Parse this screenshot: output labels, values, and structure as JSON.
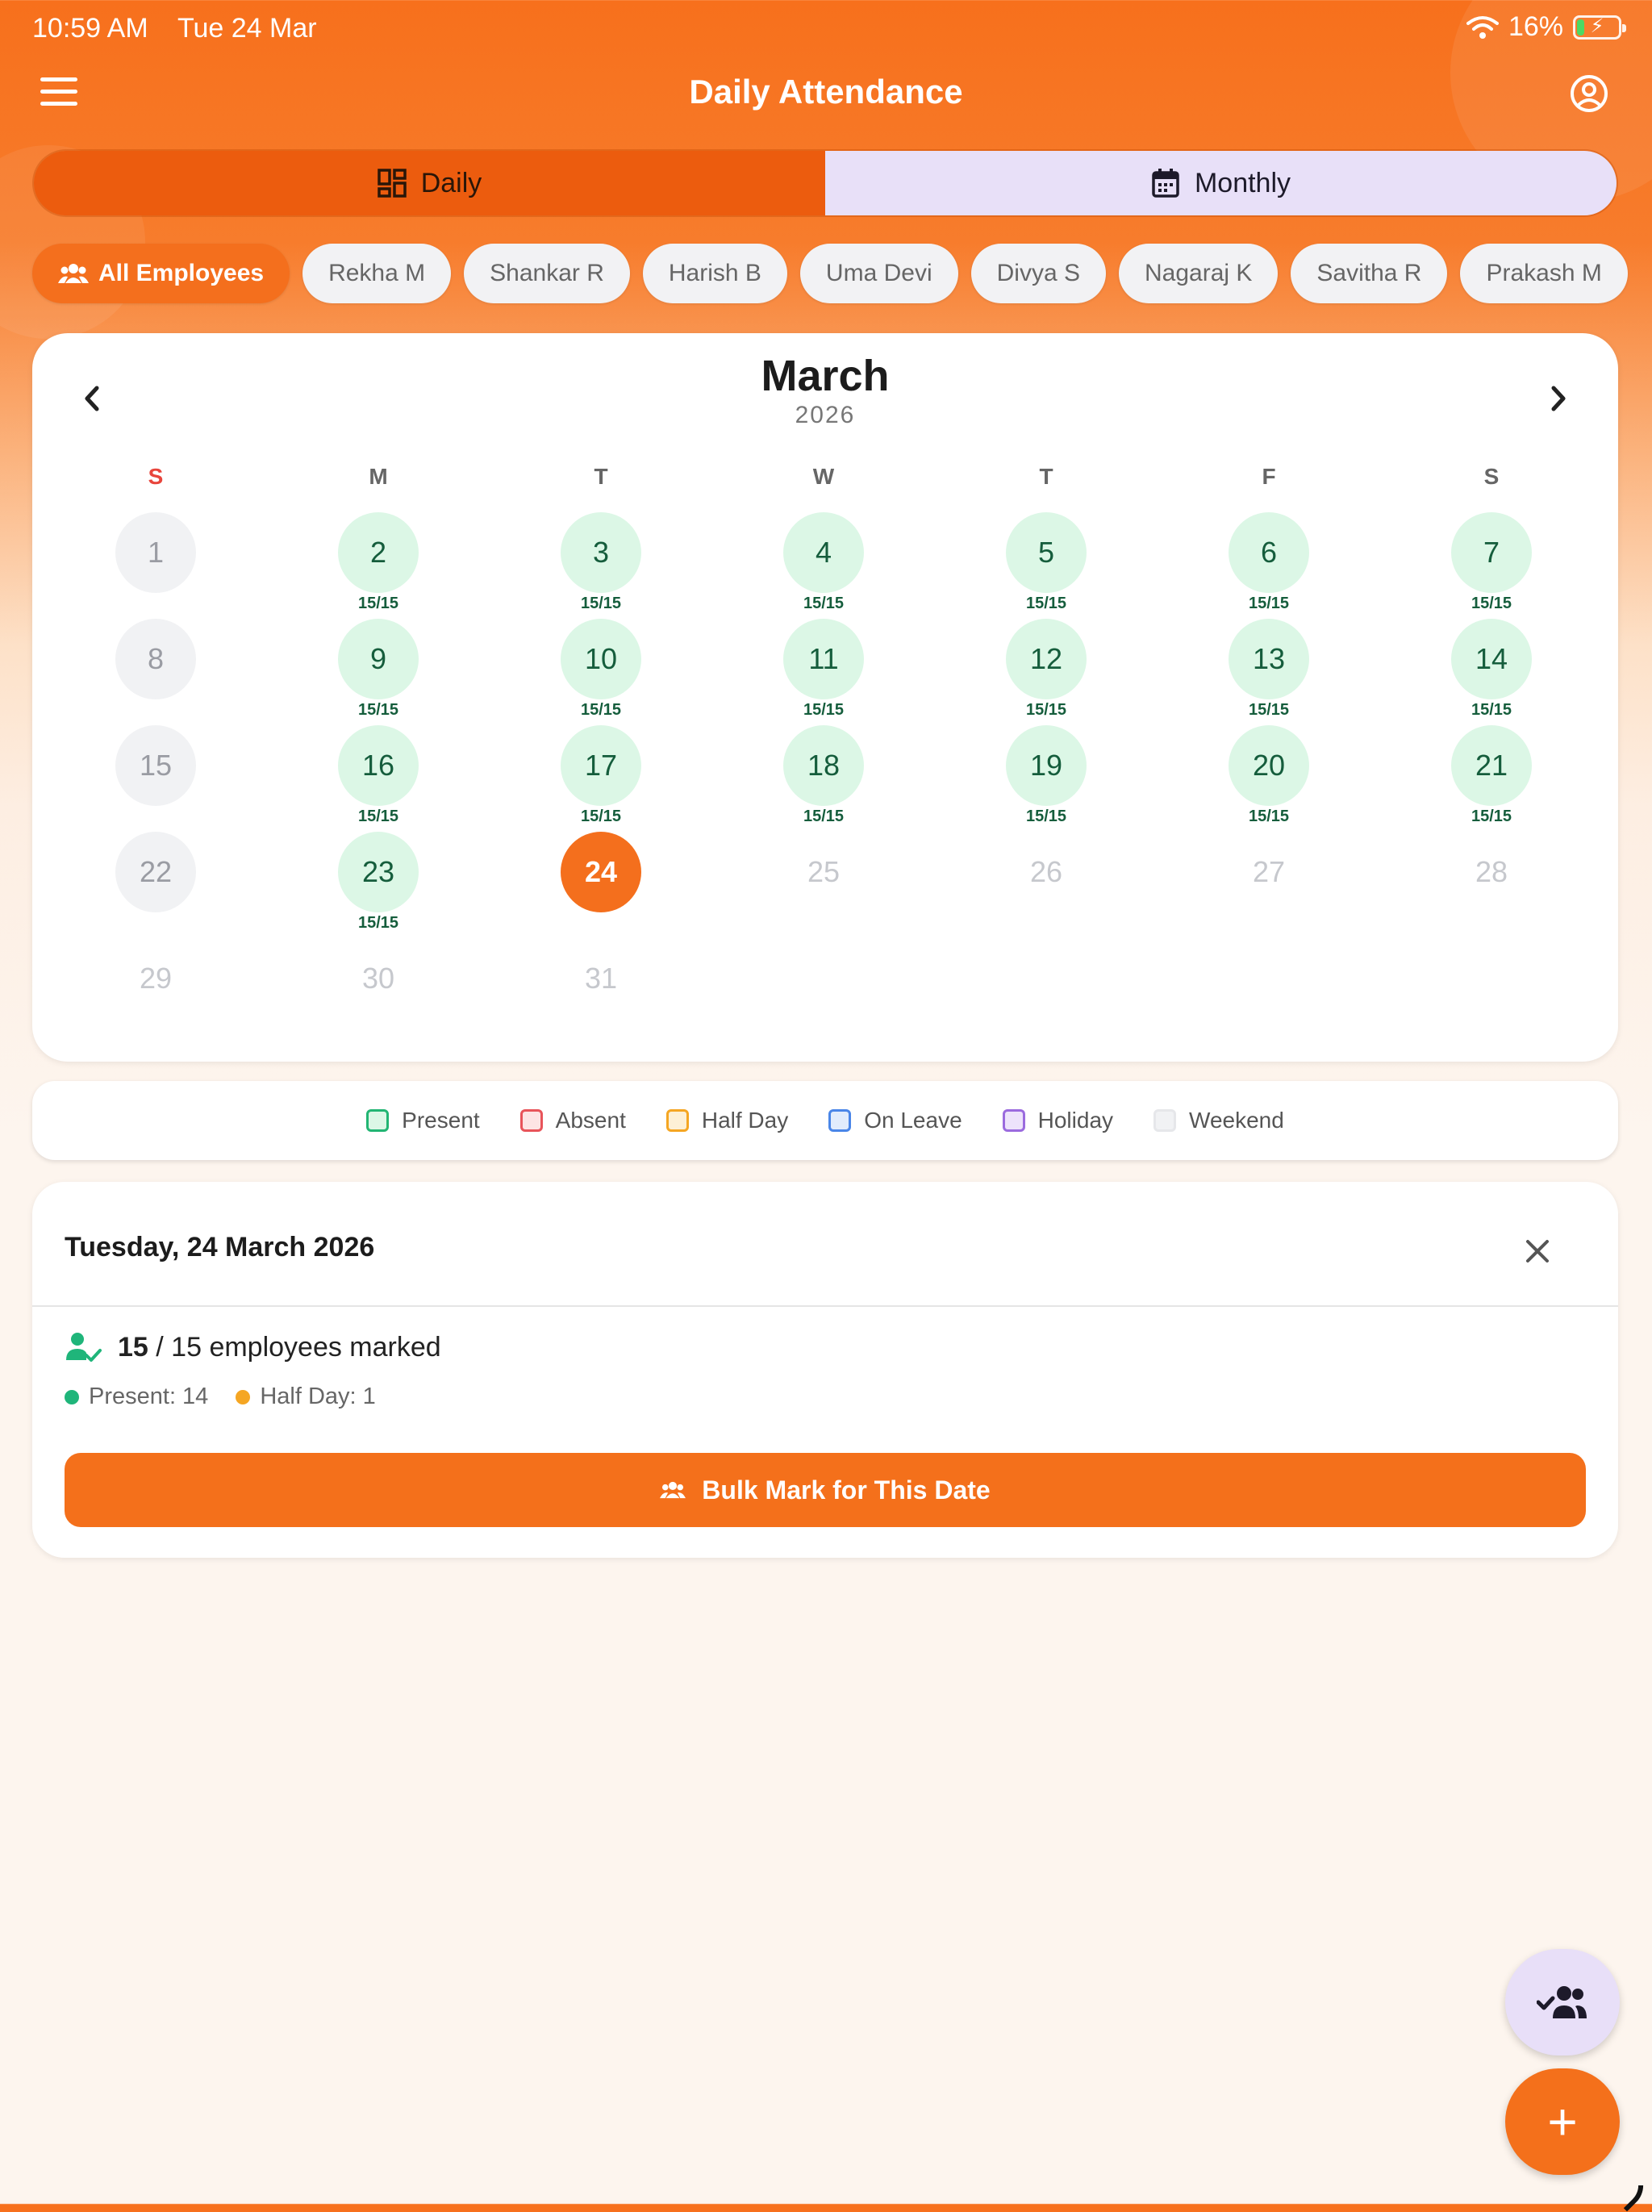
{
  "status_bar": {
    "time": "10:59 AM",
    "date": "Tue 24 Mar",
    "battery_percent": "16%",
    "battery_level": 0.16,
    "charging": true
  },
  "app_bar": {
    "title": "Daily Attendance",
    "menu_icon": "hamburger-menu-icon",
    "profile_icon": "account-circle-icon"
  },
  "view_toggle": {
    "daily_label": "Daily",
    "monthly_label": "Monthly",
    "selected": "Monthly"
  },
  "employee_filter": {
    "selected": "All Employees",
    "chips": [
      "All Employees",
      "Rekha M",
      "Shankar R",
      "Harish B",
      "Uma Devi",
      "Divya S",
      "Nagaraj K",
      "Savitha R",
      "Prakash M"
    ]
  },
  "calendar": {
    "month": "March",
    "year": "2026",
    "weekday_headers": [
      "S",
      "M",
      "T",
      "W",
      "T",
      "F",
      "S"
    ],
    "today": 24,
    "days": [
      {
        "day": "1",
        "status": "weekend",
        "count": ""
      },
      {
        "day": "2",
        "status": "present",
        "count": "15/15"
      },
      {
        "day": "3",
        "status": "present",
        "count": "15/15"
      },
      {
        "day": "4",
        "status": "present",
        "count": "15/15"
      },
      {
        "day": "5",
        "status": "present",
        "count": "15/15"
      },
      {
        "day": "6",
        "status": "present",
        "count": "15/15"
      },
      {
        "day": "7",
        "status": "present",
        "count": "15/15"
      },
      {
        "day": "8",
        "status": "weekend",
        "count": ""
      },
      {
        "day": "9",
        "status": "present",
        "count": "15/15"
      },
      {
        "day": "10",
        "status": "present",
        "count": "15/15"
      },
      {
        "day": "11",
        "status": "present",
        "count": "15/15"
      },
      {
        "day": "12",
        "status": "present",
        "count": "15/15"
      },
      {
        "day": "13",
        "status": "present",
        "count": "15/15"
      },
      {
        "day": "14",
        "status": "present",
        "count": "15/15"
      },
      {
        "day": "15",
        "status": "weekend",
        "count": ""
      },
      {
        "day": "16",
        "status": "present",
        "count": "15/15"
      },
      {
        "day": "17",
        "status": "present",
        "count": "15/15"
      },
      {
        "day": "18",
        "status": "present",
        "count": "15/15"
      },
      {
        "day": "19",
        "status": "present",
        "count": "15/15"
      },
      {
        "day": "20",
        "status": "present",
        "count": "15/15"
      },
      {
        "day": "21",
        "status": "present",
        "count": "15/15"
      },
      {
        "day": "22",
        "status": "weekend",
        "count": ""
      },
      {
        "day": "23",
        "status": "present",
        "count": "15/15"
      },
      {
        "day": "24",
        "status": "today",
        "count": ""
      },
      {
        "day": "25",
        "status": "future",
        "count": ""
      },
      {
        "day": "26",
        "status": "future",
        "count": ""
      },
      {
        "day": "27",
        "status": "future",
        "count": ""
      },
      {
        "day": "28",
        "status": "future",
        "count": ""
      },
      {
        "day": "29",
        "status": "future",
        "count": ""
      },
      {
        "day": "30",
        "status": "future",
        "count": ""
      },
      {
        "day": "31",
        "status": "future",
        "count": ""
      }
    ]
  },
  "legend": [
    {
      "label": "Present",
      "border": "#22b573",
      "fill": "#dcf7e6"
    },
    {
      "label": "Absent",
      "border": "#e8545a",
      "fill": "#fde4e4"
    },
    {
      "label": "Half Day",
      "border": "#f5a623",
      "fill": "#fdf0d6"
    },
    {
      "label": "On Leave",
      "border": "#4a86e8",
      "fill": "#e1ecfc"
    },
    {
      "label": "Holiday",
      "border": "#9b6bde",
      "fill": "#ede3fb"
    },
    {
      "label": "Weekend",
      "border": "#e6e7ea",
      "fill": "#f1f2f4"
    }
  ],
  "day_detail": {
    "date_title": "Tuesday, 24 March 2026",
    "marked_count": "15",
    "marked_rest": "/ 15 employees marked",
    "present_label": "Present: 14",
    "half_day_label": "Half Day: 1",
    "present_color": "#1fb57a",
    "half_day_color": "#f5a623",
    "bulk_button_label": "Bulk Mark for This Date"
  },
  "fabs": {
    "group_icon": "group-check-icon",
    "add_icon": "plus-icon",
    "add_symbol": "+"
  },
  "colors": {
    "accent": "#f4701b",
    "present_bg": "#dcf7e6",
    "present_text": "#155d3c"
  }
}
